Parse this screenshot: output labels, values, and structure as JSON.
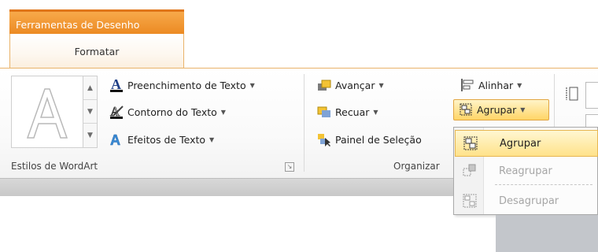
{
  "context_tab": {
    "header": "Ferramentas de Desenho",
    "tab": "Formatar"
  },
  "wordart": {
    "gallery_glyph": "A",
    "commands": [
      {
        "label": "Preenchimento de Texto",
        "icon": "text-fill-icon"
      },
      {
        "label": "Contorno do Texto",
        "icon": "text-outline-icon"
      },
      {
        "label": "Efeitos de Texto",
        "icon": "text-effects-icon"
      }
    ],
    "group_label": "Estilos de WordArt"
  },
  "organize": {
    "avancar": "Avançar",
    "recuar": "Recuar",
    "painel": "Painel de Seleção",
    "alinhar": "Alinhar",
    "agrupar": "Agrupar",
    "group_label": "Organizar"
  },
  "dropdown": {
    "items": [
      {
        "label": "Agrupar",
        "state": "highlighted",
        "icon": "group-icon"
      },
      {
        "label": "Reagrupar",
        "state": "disabled",
        "icon": "regroup-icon"
      },
      {
        "label": "Desagrupar",
        "state": "disabled",
        "icon": "ungroup-icon"
      }
    ]
  },
  "colors": {
    "accent": "#ec8a23",
    "highlight": "#ffe28a"
  }
}
